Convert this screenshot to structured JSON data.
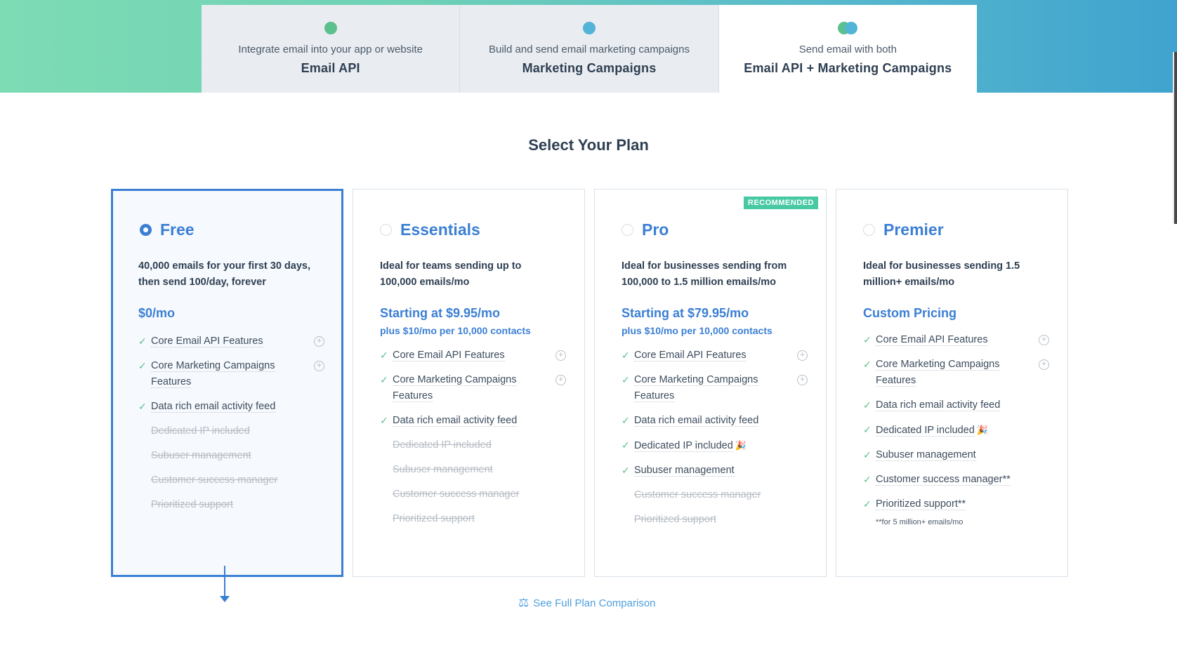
{
  "tabs": [
    {
      "subtitle": "Integrate email into your app or website",
      "title": "Email API",
      "dots": [
        "green"
      ],
      "active": false
    },
    {
      "subtitle": "Build and send email marketing campaigns",
      "title": "Marketing Campaigns",
      "dots": [
        "blue"
      ],
      "active": false
    },
    {
      "subtitle": "Send email with both",
      "title": "Email API + Marketing Campaigns",
      "dots": [
        "green",
        "blue"
      ],
      "active": true
    }
  ],
  "heading": "Select Your Plan",
  "plans": [
    {
      "name": "Free",
      "selected": true,
      "description": "40,000 emails for your first 30 days, then send 100/day, forever",
      "price": "$0/mo",
      "price_sub": "",
      "features": [
        {
          "label": "Core Email API Features",
          "included": true,
          "expandable": true
        },
        {
          "label": "Core Marketing Campaigns Features",
          "included": true,
          "expandable": true
        },
        {
          "label": "Data rich email activity feed",
          "included": true
        },
        {
          "label": "Dedicated IP included",
          "included": false
        },
        {
          "label": "Subuser management",
          "included": false
        },
        {
          "label": "Customer success manager",
          "included": false
        },
        {
          "label": "Prioritized support",
          "included": false
        }
      ]
    },
    {
      "name": "Essentials",
      "selected": false,
      "description": "Ideal for teams sending up to 100,000 emails/mo",
      "price": "Starting at $9.95/mo",
      "price_sub": "plus $10/mo per 10,000 contacts",
      "features": [
        {
          "label": "Core Email API Features",
          "included": true,
          "expandable": true
        },
        {
          "label": "Core Marketing Campaigns Features",
          "included": true,
          "expandable": true
        },
        {
          "label": "Data rich email activity feed",
          "included": true
        },
        {
          "label": "Dedicated IP included",
          "included": false
        },
        {
          "label": "Subuser management",
          "included": false
        },
        {
          "label": "Customer success manager",
          "included": false
        },
        {
          "label": "Prioritized support",
          "included": false
        }
      ]
    },
    {
      "name": "Pro",
      "selected": false,
      "badge": "RECOMMENDED",
      "description": "Ideal for businesses sending from 100,000 to 1.5 million emails/mo",
      "price": "Starting at $79.95/mo",
      "price_sub": "plus $10/mo per 10,000 contacts",
      "features": [
        {
          "label": "Core Email API Features",
          "included": true,
          "expandable": true
        },
        {
          "label": "Core Marketing Campaigns Features",
          "included": true,
          "expandable": true
        },
        {
          "label": "Data rich email activity feed",
          "included": true
        },
        {
          "label": "Dedicated IP included",
          "included": true,
          "icon": "party-icon"
        },
        {
          "label": "Subuser management",
          "included": true
        },
        {
          "label": "Customer success manager",
          "included": false
        },
        {
          "label": "Prioritized support",
          "included": false
        }
      ]
    },
    {
      "name": "Premier",
      "selected": false,
      "description": "Ideal for businesses sending 1.5 million+ emails/mo",
      "price": "Custom Pricing",
      "price_sub": "",
      "features": [
        {
          "label": "Core Email API Features",
          "included": true,
          "expandable": true
        },
        {
          "label": "Core Marketing Campaigns Features",
          "included": true,
          "expandable": true
        },
        {
          "label": "Data rich email activity feed",
          "included": true
        },
        {
          "label": "Dedicated IP included",
          "included": true,
          "icon": "party-icon"
        },
        {
          "label": "Subuser management",
          "included": true
        },
        {
          "label": "Customer success manager**",
          "included": true
        },
        {
          "label": "Prioritized support**",
          "included": true
        }
      ],
      "note": "**for 5 million+ emails/mo"
    }
  ],
  "compare_link": "See Full Plan Comparison",
  "colors": {
    "accent": "#3b7fd4",
    "check": "#5cbf8e",
    "badge": "#47c9a4"
  }
}
